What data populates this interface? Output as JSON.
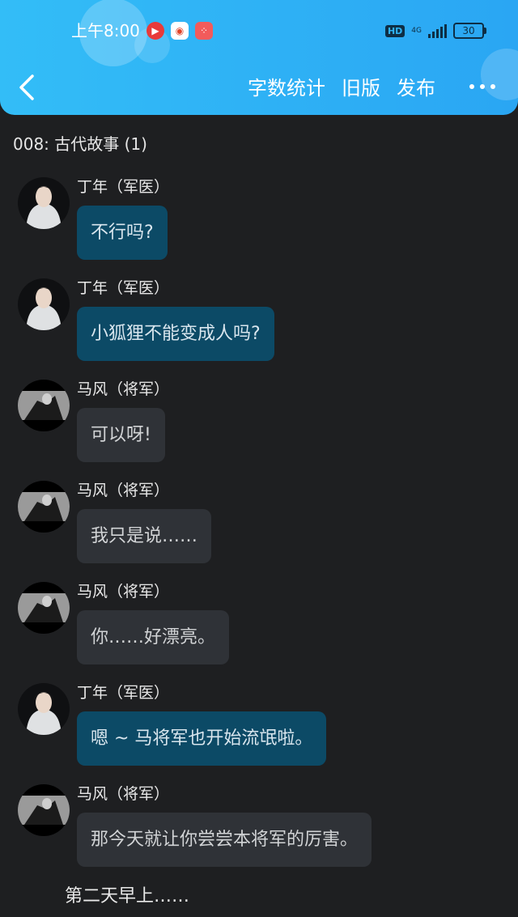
{
  "status_bar": {
    "time": "上午8:00",
    "hd_label": "HD",
    "network_label": "4G",
    "battery_level": "30"
  },
  "header": {
    "actions": [
      "字数统计",
      "旧版",
      "发布"
    ]
  },
  "chapter_title": "008: 古代故事 (1)",
  "messages": [
    {
      "sender": "丁年（军医）",
      "text": "不行吗?",
      "style": "blue"
    },
    {
      "sender": "丁年（军医）",
      "text": "小狐狸不能变成人吗?",
      "style": "blue"
    },
    {
      "sender": "马风（将军）",
      "text": "可以呀!",
      "style": "gray"
    },
    {
      "sender": "马风（将军）",
      "text": "我只是说……",
      "style": "gray"
    },
    {
      "sender": "马风（将军）",
      "text": "你……好漂亮。",
      "style": "gray"
    },
    {
      "sender": "丁年（军医）",
      "text": "嗯 ~ 马将军也开始流氓啦。",
      "style": "blue"
    },
    {
      "sender": "马风（将军）",
      "text": "那今天就让你尝尝本将军的厉害。",
      "style": "gray"
    }
  ],
  "narration": "第二天早上……",
  "colors": {
    "header_blue": "#2fb4f5",
    "bubble_blue": "#0c4a66",
    "bubble_gray": "#2f3237",
    "background": "#1e1f21"
  }
}
